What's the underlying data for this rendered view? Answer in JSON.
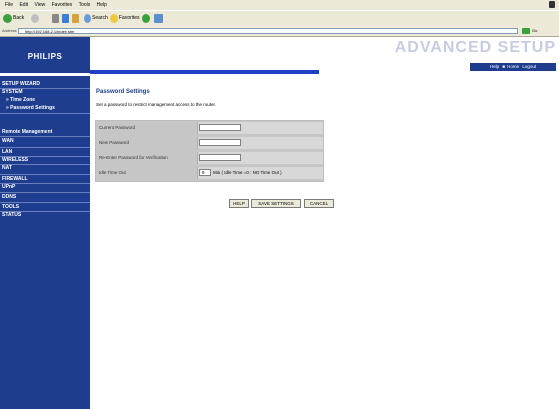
{
  "browser": {
    "menu": [
      "File",
      "Edit",
      "View",
      "Favorites",
      "Tools",
      "Help"
    ],
    "toolbar": {
      "back": "Back",
      "search": "Search",
      "favorites": "Favorites"
    },
    "address_label": "Address",
    "address_value": "http://192.168.2.1/index.stm",
    "go_label": "Go"
  },
  "header": {
    "logo": "PHILIPS",
    "title": "ADVANCED SETUP",
    "links": [
      "Help",
      "Home",
      "Logout"
    ]
  },
  "sidebar": {
    "items": [
      {
        "label": "SETUP WIZARD",
        "type": "section"
      },
      {
        "label": "SYSTEM",
        "type": "section"
      },
      {
        "label": "» Time Zone",
        "type": "sub"
      },
      {
        "label": "» Password Settings",
        "type": "sub"
      },
      {
        "label": "Remote Management",
        "type": "section"
      },
      {
        "label": "WAN",
        "type": "section"
      },
      {
        "label": "LAN",
        "type": "section"
      },
      {
        "label": "WIRELESS",
        "type": "section"
      },
      {
        "label": "NAT",
        "type": "section"
      },
      {
        "label": "FIREWALL",
        "type": "section"
      },
      {
        "label": "UPnP",
        "type": "section"
      },
      {
        "label": "DDNS",
        "type": "section"
      },
      {
        "label": "TOOLS",
        "type": "section"
      },
      {
        "label": "STATUS",
        "type": "section"
      }
    ]
  },
  "main": {
    "title": "Password Settings",
    "description": "Set a password to restrict management access to the router.",
    "fields": {
      "current_password": "Current Password",
      "new_password": "New Password",
      "reenter_password": "Re-Enter Password for Verification",
      "idle_timeout": "Idle Time Out",
      "idle_value": "9",
      "idle_hint": "Min ( Idle Time =0 : NO Time Out )"
    },
    "buttons": {
      "help": "HELP",
      "save": "SAVE SETTINGS",
      "cancel": "CANCEL"
    }
  }
}
